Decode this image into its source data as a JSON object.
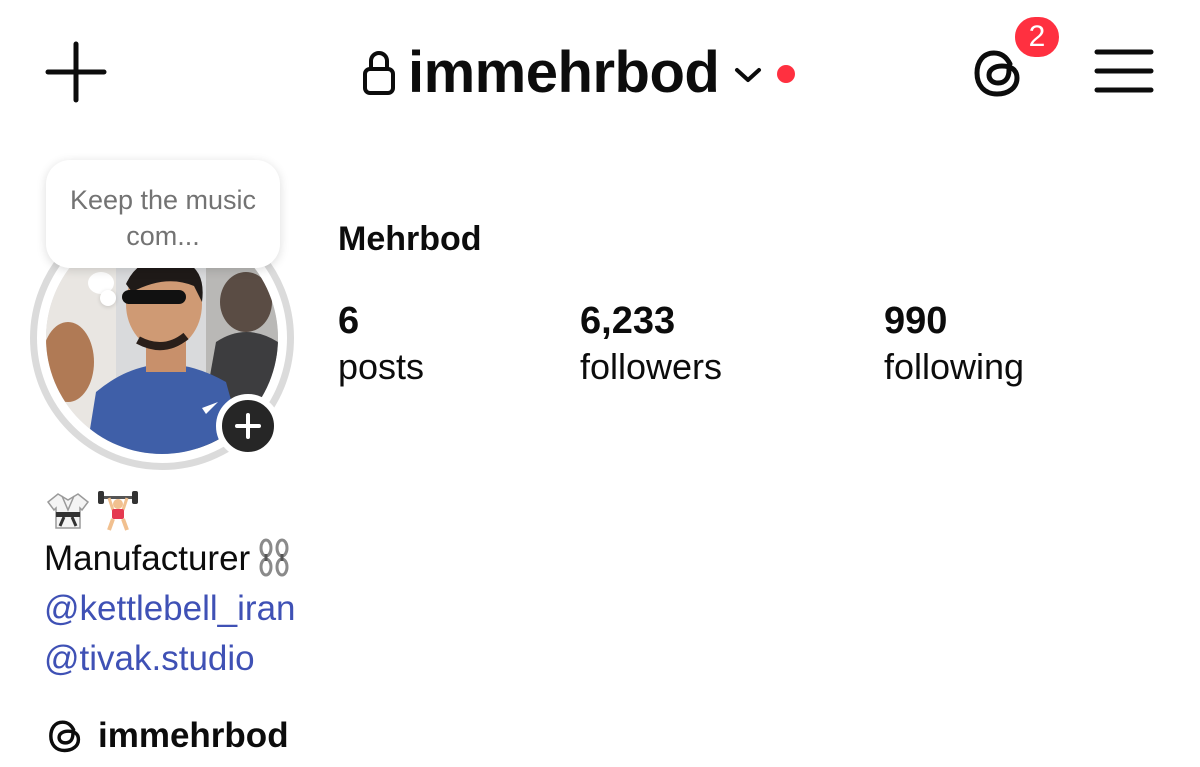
{
  "header": {
    "username": "immehrbod",
    "notification_count": "2"
  },
  "note": {
    "text": "Keep the music com..."
  },
  "profile": {
    "display_name": "Mehrbod",
    "stats": [
      {
        "value": "6",
        "label": "posts"
      },
      {
        "value": "6,233",
        "label": "followers"
      },
      {
        "value": "990",
        "label": "following"
      }
    ]
  },
  "bio": {
    "line": "Manufacturer",
    "mentions": [
      "@kettlebell_iran",
      "@tivak.studio"
    ],
    "threads_handle": "immehrbod"
  },
  "colors": {
    "accent_red": "#ff3040",
    "mention_blue": "#3f51b5",
    "text": "#0c0c0c",
    "muted": "#737373"
  },
  "icons": [
    "plus-icon",
    "lock-icon",
    "chevron-down-icon",
    "threads-icon",
    "menu-icon",
    "add-story-icon",
    "karate-uniform-emoji",
    "weightlifter-emoji",
    "chain-emoji"
  ]
}
